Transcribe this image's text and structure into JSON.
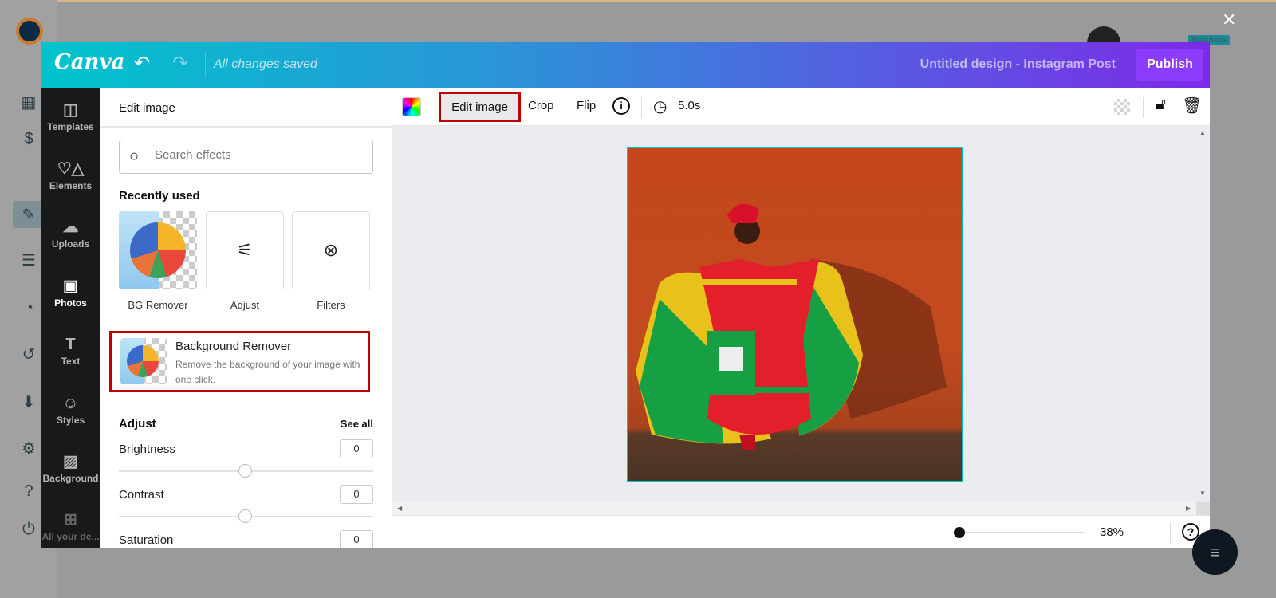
{
  "host": {
    "close_icon": "close-icon",
    "badge": "Business"
  },
  "header": {
    "logo": "Canva",
    "status": "All changes saved",
    "design_title": "Untitled design - Instagram Post",
    "publish": "Publish",
    "undo_icon": "undo-icon",
    "redo_icon": "redo-icon"
  },
  "nav": {
    "items": [
      {
        "label": "Templates",
        "icon": "templates-icon"
      },
      {
        "label": "Elements",
        "icon": "elements-icon"
      },
      {
        "label": "Uploads",
        "icon": "upload-icon"
      },
      {
        "label": "Photos",
        "icon": "photos-icon",
        "active": true
      },
      {
        "label": "Text",
        "icon": "text-icon"
      },
      {
        "label": "Styles",
        "icon": "palette-icon"
      },
      {
        "label": "Background",
        "icon": "background-icon"
      },
      {
        "label": "All your de...",
        "icon": "grid-icon"
      }
    ]
  },
  "panel": {
    "title": "Edit image",
    "search_placeholder": "Search effects",
    "recent_title": "Recently used",
    "recent": [
      {
        "label": "BG Remover"
      },
      {
        "label": "Adjust"
      },
      {
        "label": "Filters"
      }
    ],
    "bg_remover": {
      "title": "Background Remover",
      "desc": "Remove the background of your image with one click."
    },
    "adjust_title": "Adjust",
    "see_all": "See all",
    "sliders": [
      {
        "label": "Brightness",
        "value": "0"
      },
      {
        "label": "Contrast",
        "value": "0"
      },
      {
        "label": "Saturation",
        "value": "0"
      }
    ]
  },
  "toolbar": {
    "edit_image": "Edit image",
    "crop": "Crop",
    "flip": "Flip",
    "duration": "5.0s"
  },
  "footer": {
    "zoom": "38%",
    "zoom_fraction": 0.05
  },
  "colors": {
    "accent": "#8b3dff",
    "highlight": "#c00000",
    "teal": "#00c4cc"
  }
}
